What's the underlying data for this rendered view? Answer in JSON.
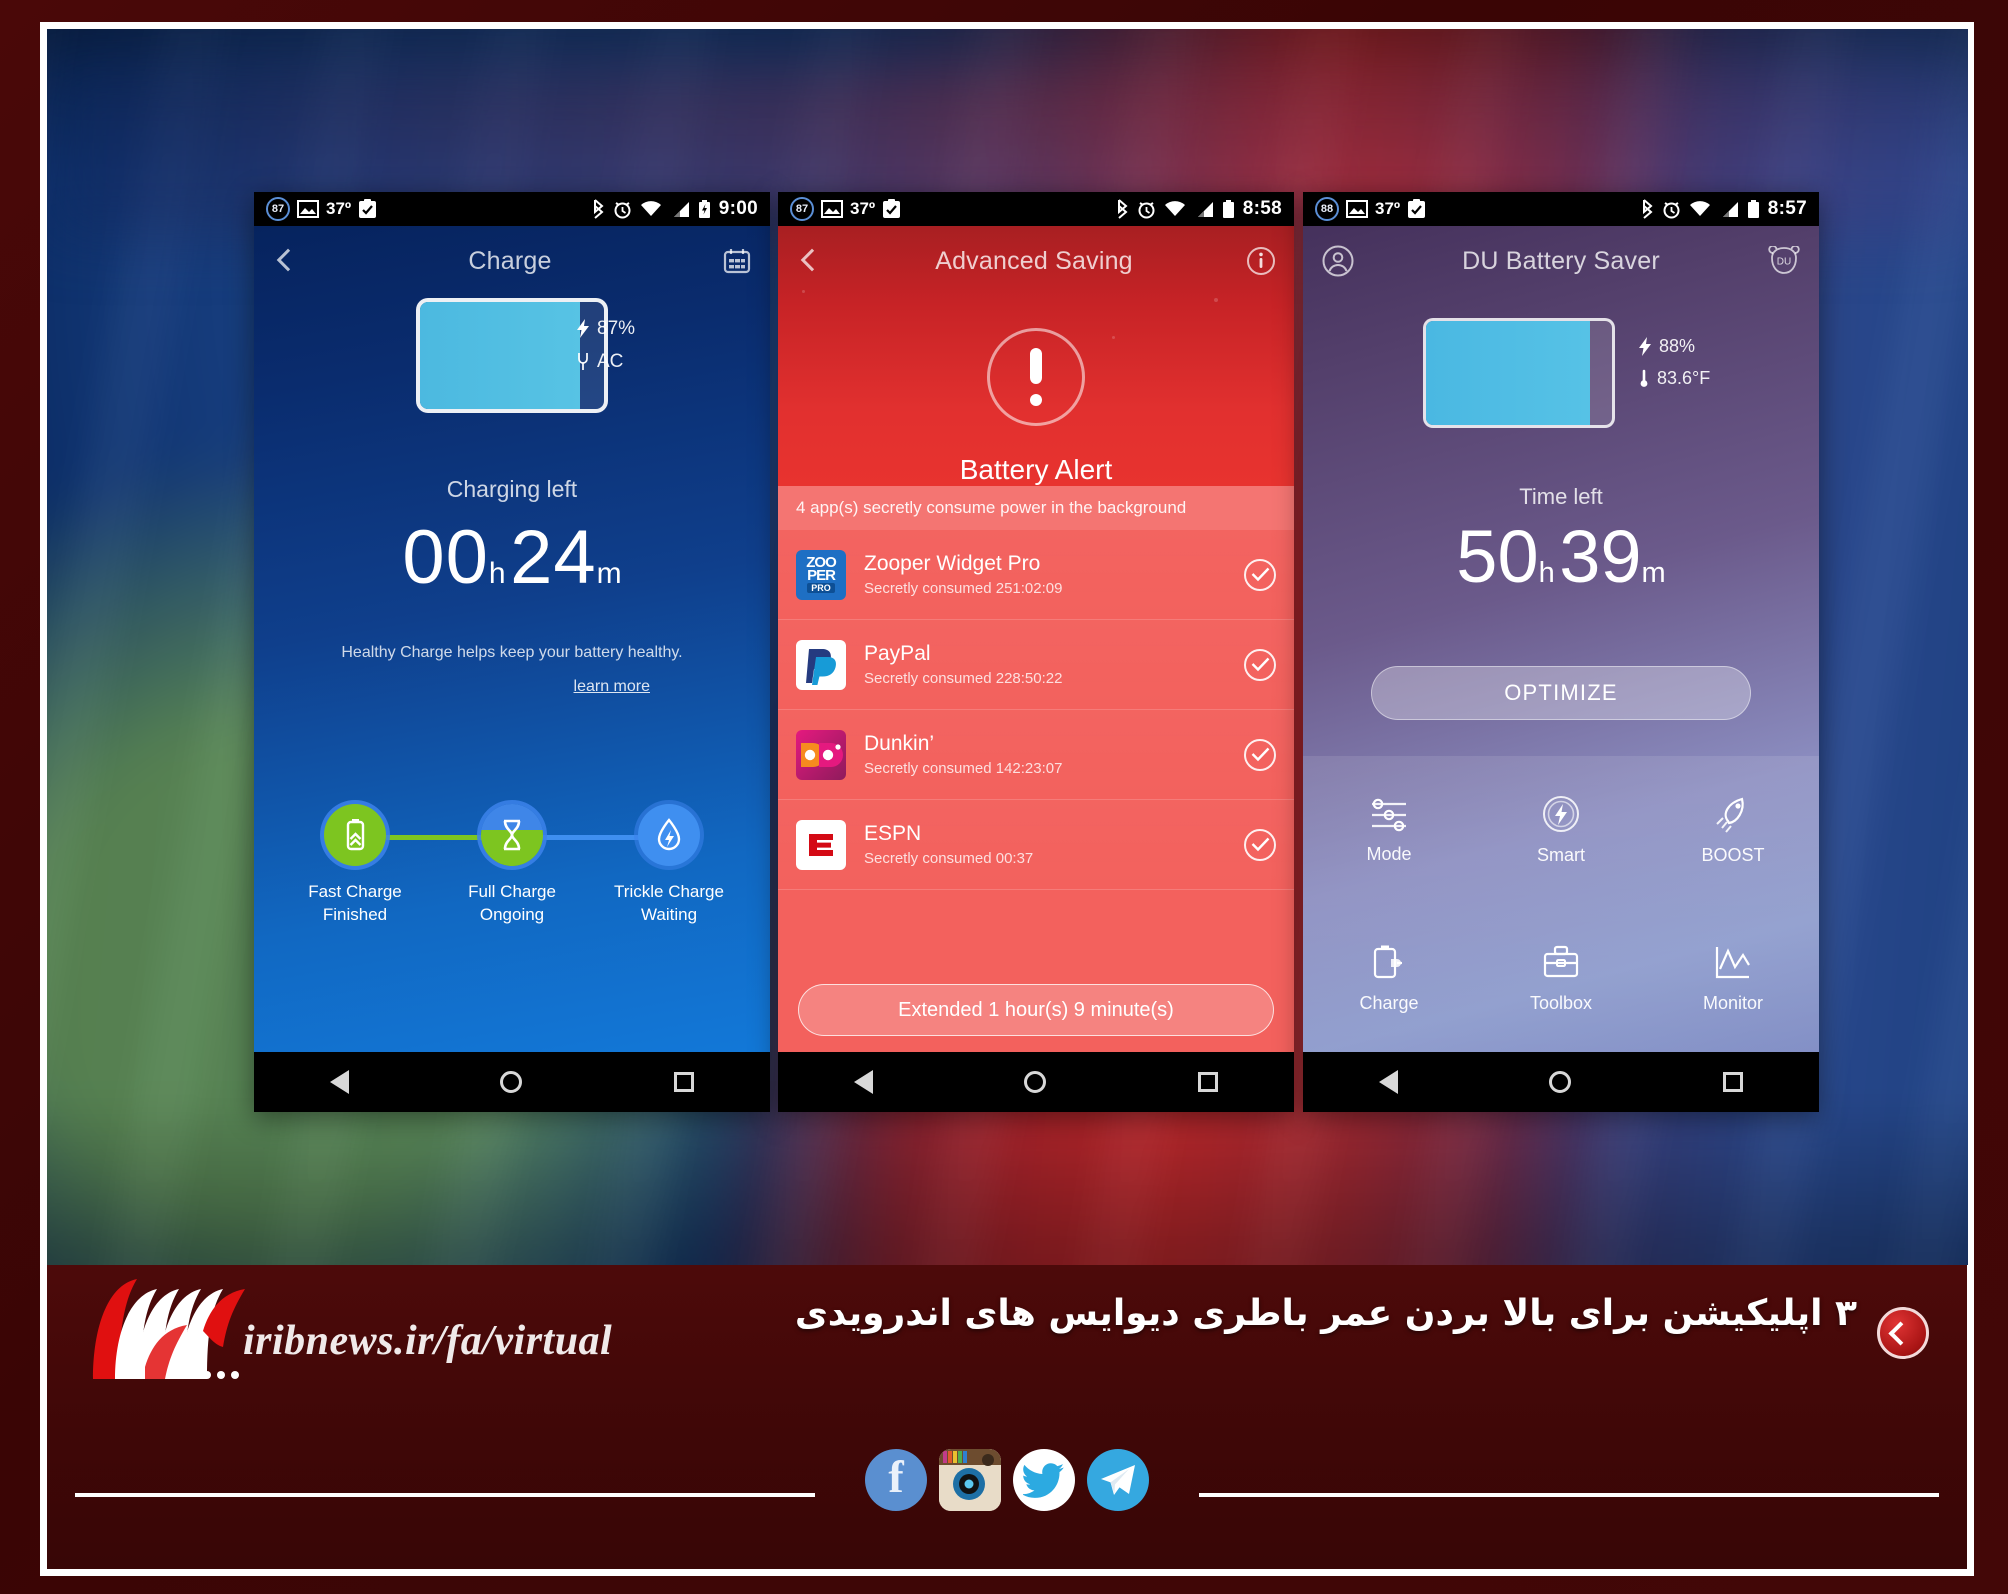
{
  "page": {
    "frame_color": "#3d0606",
    "accent_red": "#b2252c"
  },
  "phones": [
    {
      "id": "charge",
      "status_bar": {
        "battery_badge": "87",
        "temperature": "37º",
        "icons": [
          "image-icon",
          "clipboard-check-icon",
          "bluetooth-icon",
          "alarm-icon",
          "wifi-icon",
          "signal-icon",
          "battery-charging-icon"
        ],
        "time": "9:00"
      },
      "appbar": {
        "back": "back-chevron-icon",
        "title": "Charge",
        "action": "calendar-icon"
      },
      "battery": {
        "percent": "87%",
        "percent_value": 87,
        "source_label": "AC",
        "charge_icon": "bolt-icon",
        "plug_icon": "ac-plug-icon"
      },
      "time_label": "Charging left",
      "hours": "00",
      "hours_unit": "h",
      "minutes": "24",
      "minutes_unit": "m",
      "description": "Healthy Charge helps keep your battery healthy.",
      "learn_more": "learn more",
      "stages": [
        {
          "icon": "battery-boost-icon",
          "title": "Fast Charge",
          "state": "Finished",
          "color": "#7dc520"
        },
        {
          "icon": "hourglass-icon",
          "title": "Full Charge",
          "state": "Ongoing",
          "color": "#7dc520"
        },
        {
          "icon": "droplet-bolt-icon",
          "title": "Trickle Charge",
          "state": "Waiting",
          "color": "#3f8ff0"
        }
      ],
      "navbar": [
        "back-triangle-icon",
        "home-circle-icon",
        "recents-square-icon"
      ]
    },
    {
      "id": "advanced-saving",
      "status_bar": {
        "battery_badge": "87",
        "temperature": "37º",
        "icons": [
          "image-icon",
          "clipboard-check-icon",
          "bluetooth-icon",
          "alarm-icon",
          "wifi-icon",
          "signal-icon",
          "battery-icon"
        ],
        "time": "8:58"
      },
      "appbar": {
        "back": "back-chevron-icon",
        "title": "Advanced Saving",
        "action": "info-icon"
      },
      "alert": {
        "icon": "exclamation-circle-icon",
        "title": "Battery Alert"
      },
      "subhead": "4 app(s) secretly consume power in the background",
      "apps": [
        {
          "icon": "zooper-widget-pro-icon",
          "name": "Zooper Widget Pro",
          "consumed": "Secretly consumed 251:02:09",
          "checked": true
        },
        {
          "icon": "paypal-icon",
          "name": "PayPal",
          "consumed": "Secretly consumed 228:50:22",
          "checked": true
        },
        {
          "icon": "dunkin-icon",
          "name": "Dunkin’",
          "consumed": "Secretly consumed 142:23:07",
          "checked": true
        },
        {
          "icon": "espn-icon",
          "name": "ESPN",
          "consumed": "Secretly consumed 00:37",
          "checked": true
        }
      ],
      "action_button": "Extended 1 hour(s) 9 minute(s)",
      "navbar": [
        "back-triangle-icon",
        "home-circle-icon",
        "recents-square-icon"
      ]
    },
    {
      "id": "du-battery-saver",
      "status_bar": {
        "battery_badge": "88",
        "temperature": "37º",
        "icons": [
          "image-icon",
          "clipboard-check-icon",
          "bluetooth-icon",
          "alarm-icon",
          "wifi-icon",
          "signal-icon",
          "battery-icon"
        ],
        "time": "8:57"
      },
      "appbar": {
        "back": "account-circle-icon",
        "title": "DU Battery Saver",
        "action": "du-bear-icon"
      },
      "battery": {
        "percent": "88%",
        "percent_value": 88,
        "temperature": "83.6°F",
        "charge_icon": "bolt-icon",
        "thermometer_icon": "thermometer-icon"
      },
      "time_label": "Time left",
      "hours": "50",
      "hours_unit": "h",
      "minutes": "39",
      "minutes_unit": "m",
      "optimize_button": "OPTIMIZE",
      "tools": [
        {
          "icon": "sliders-icon",
          "label": "Mode"
        },
        {
          "icon": "smart-bolt-icon",
          "label": "Smart"
        },
        {
          "icon": "rocket-icon",
          "label": "BOOST"
        },
        {
          "icon": "battery-plug-icon",
          "label": "Charge"
        },
        {
          "icon": "toolbox-icon",
          "label": "Toolbox"
        },
        {
          "icon": "chart-line-icon",
          "label": "Monitor"
        }
      ],
      "navbar": [
        "back-triangle-icon",
        "home-circle-icon",
        "recents-square-icon"
      ]
    }
  ],
  "banner": {
    "logo_name": "irib-logo",
    "url": "iribnews.ir/fa/virtual",
    "headline": "۳ اپلیکیشن برای بالا بردن عمر باطری دیوایس های اندرویدی",
    "prev_button": "previous-arrow-icon",
    "socials": [
      {
        "name": "facebook-icon",
        "glyph": "f"
      },
      {
        "name": "instagram-icon",
        "glyph": ""
      },
      {
        "name": "twitter-icon",
        "glyph": ""
      },
      {
        "name": "telegram-icon",
        "glyph": ""
      }
    ]
  }
}
